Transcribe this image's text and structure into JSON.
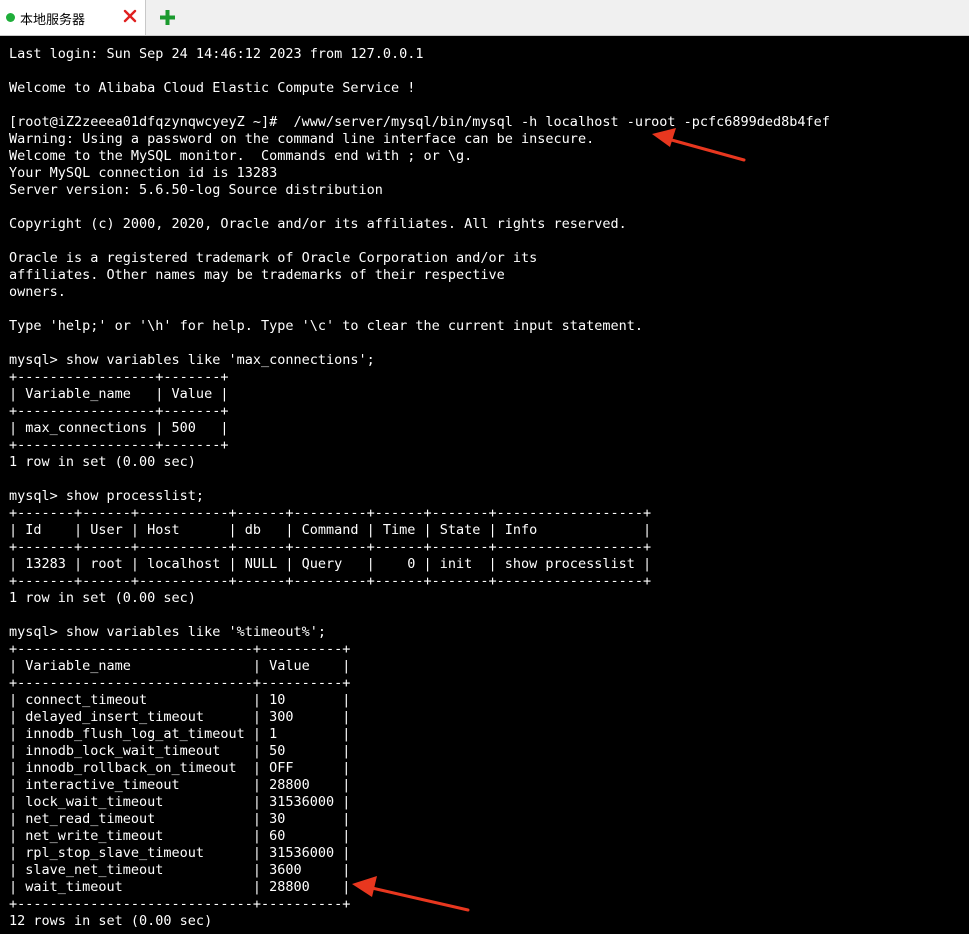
{
  "tab": {
    "title": "本地服务器",
    "status_color": "#1fae3a",
    "close_icon": "close-icon",
    "new_tab_icon": "plus-icon"
  },
  "terminal": {
    "lines": [
      "Last login: Sun Sep 24 14:46:12 2023 from 127.0.0.1",
      "",
      "Welcome to Alibaba Cloud Elastic Compute Service !",
      "",
      "[root@iZ2zeeea01dfqzynqwcyeyZ ~]#  /www/server/mysql/bin/mysql -h localhost -uroot -pcfc6899ded8b4fef",
      "Warning: Using a password on the command line interface can be insecure.",
      "Welcome to the MySQL monitor.  Commands end with ; or \\g.",
      "Your MySQL connection id is 13283",
      "Server version: 5.6.50-log Source distribution",
      "",
      "Copyright (c) 2000, 2020, Oracle and/or its affiliates. All rights reserved.",
      "",
      "Oracle is a registered trademark of Oracle Corporation and/or its",
      "affiliates. Other names may be trademarks of their respective",
      "owners.",
      "",
      "Type 'help;' or '\\h' for help. Type '\\c' to clear the current input statement.",
      "",
      "mysql> show variables like 'max_connections';",
      "+-----------------+-------+",
      "| Variable_name   | Value |",
      "+-----------------+-------+",
      "| max_connections | 500   |",
      "+-----------------+-------+",
      "1 row in set (0.00 sec)",
      "",
      "mysql> show processlist;",
      "+-------+------+-----------+------+---------+------+-------+------------------+",
      "| Id    | User | Host      | db   | Command | Time | State | Info             |",
      "+-------+------+-----------+------+---------+------+-------+------------------+",
      "| 13283 | root | localhost | NULL | Query   |    0 | init  | show processlist |",
      "+-------+------+-----------+------+---------+------+-------+------------------+",
      "1 row in set (0.00 sec)",
      "",
      "mysql> show variables like '%timeout%';",
      "+-----------------------------+----------+",
      "| Variable_name               | Value    |",
      "+-----------------------------+----------+",
      "| connect_timeout             | 10       |",
      "| delayed_insert_timeout      | 300      |",
      "| innodb_flush_log_at_timeout | 1        |",
      "| innodb_lock_wait_timeout    | 50       |",
      "| innodb_rollback_on_timeout  | OFF      |",
      "| interactive_timeout         | 28800    |",
      "| lock_wait_timeout           | 31536000 |",
      "| net_read_timeout            | 30       |",
      "| net_write_timeout           | 60       |",
      "| rpl_stop_slave_timeout      | 31536000 |",
      "| slave_net_timeout           | 3600     |",
      "| wait_timeout                | 28800    |",
      "+-----------------------------+----------+",
      "12 rows in set (0.00 sec)"
    ]
  },
  "annotations": {
    "arrow_color": "#e8371f"
  }
}
